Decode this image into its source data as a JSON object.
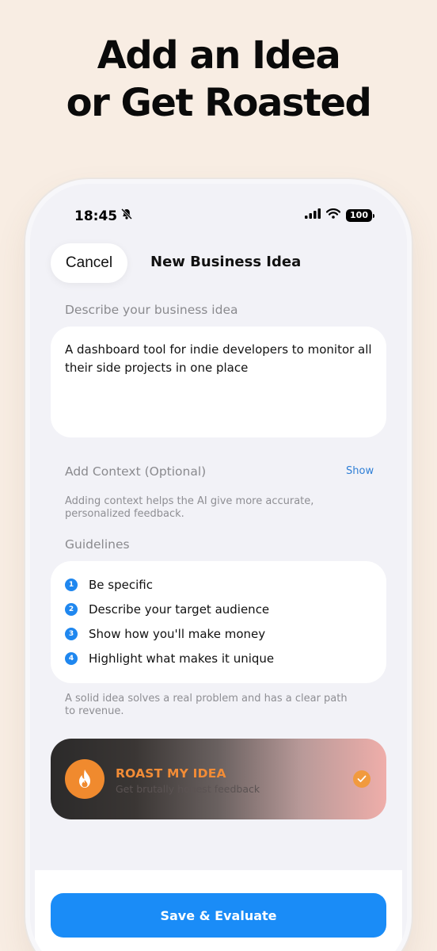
{
  "headline": {
    "line1": "Add an Idea",
    "line2": "or Get Roasted"
  },
  "status_bar": {
    "time": "18:45",
    "battery": "100"
  },
  "nav": {
    "cancel_label": "Cancel",
    "title": "New Business Idea"
  },
  "idea": {
    "label": "Describe your business idea",
    "text": "A dashboard tool for indie developers to monitor all their side projects in one place"
  },
  "context": {
    "label": "Add Context (Optional)",
    "toggle_label": "Show",
    "hint": "Adding context helps the AI give more accurate, personalized feedback."
  },
  "guidelines": {
    "label": "Guidelines",
    "items": [
      {
        "number": "1",
        "text": "Be specific"
      },
      {
        "number": "2",
        "text": "Describe your target audience"
      },
      {
        "number": "3",
        "text": "Show how you'll make money"
      },
      {
        "number": "4",
        "text": "Highlight what makes it unique"
      }
    ],
    "footer": "A solid idea solves a real problem and has a clear path to revenue."
  },
  "roast": {
    "title": "ROAST MY IDEA",
    "subtitle": "Get brutally honest feedback",
    "selected": true
  },
  "save_button": {
    "label": "Save & Evaluate"
  },
  "colors": {
    "background": "#f8ede3",
    "accent_blue": "#1a8cf7",
    "roast_orange": "#f08a2e"
  }
}
